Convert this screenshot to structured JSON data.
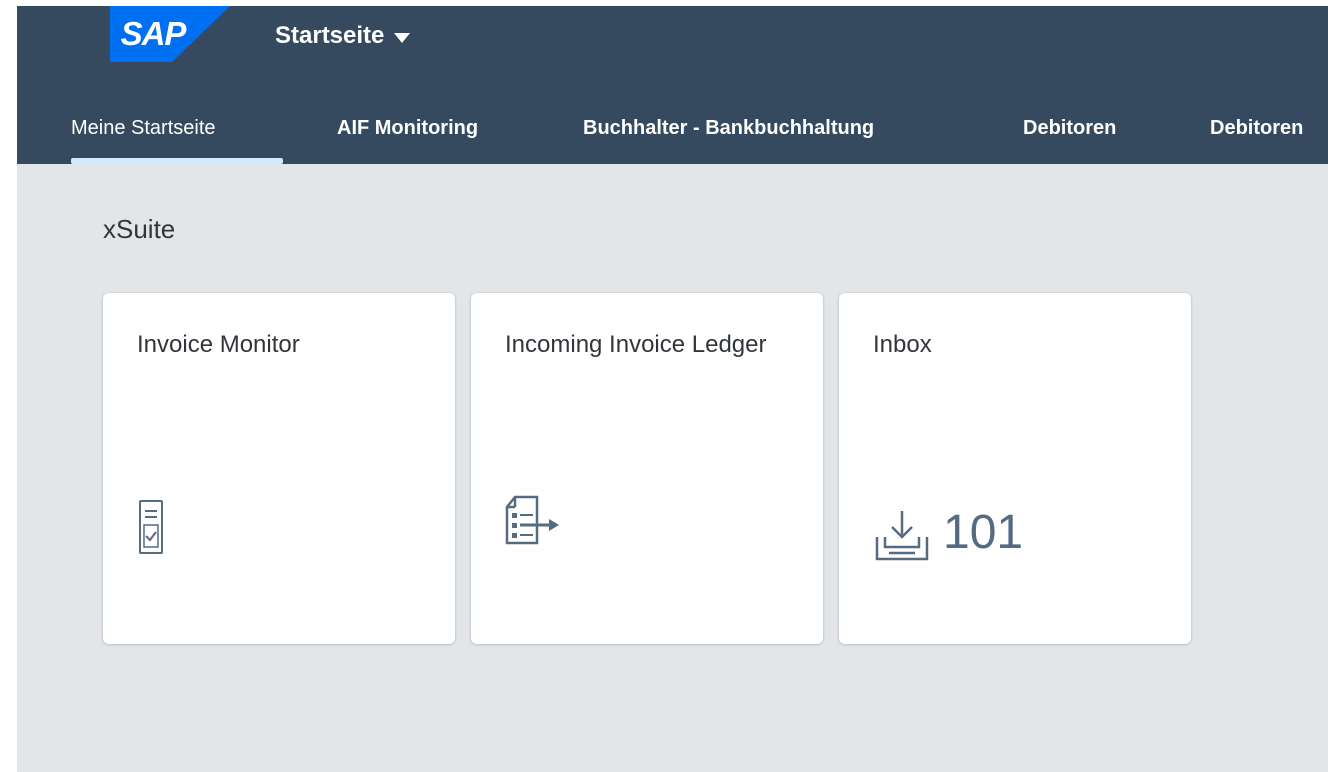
{
  "header": {
    "logo_text": "SAP",
    "app_title": "Startseite",
    "colors": {
      "shell": "#354a5f",
      "logo": "#0070f2",
      "background": "#e3e6e9"
    }
  },
  "tabs": [
    {
      "label": "Meine Startseite",
      "active": true
    },
    {
      "label": "AIF Monitoring"
    },
    {
      "label": "Buchhalter - Bankbuchhaltung"
    },
    {
      "label": "Debitoren"
    },
    {
      "label": "Debitoren"
    }
  ],
  "group": {
    "title": "xSuite",
    "tiles": [
      {
        "title": "Invoice Monitor",
        "icon": "document-check-icon"
      },
      {
        "title": "Incoming Invoice Ledger",
        "icon": "task-list-icon"
      },
      {
        "title": "Inbox",
        "icon": "inbox-download-icon",
        "count": "101"
      }
    ]
  }
}
